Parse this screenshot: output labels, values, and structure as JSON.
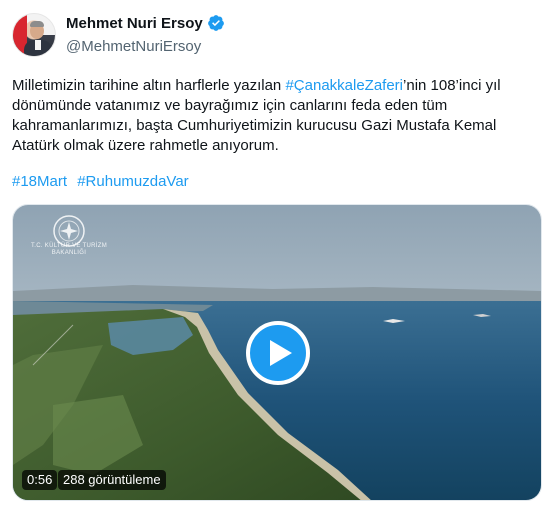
{
  "author": {
    "display_name": "Mehmet Nuri Ersoy",
    "handle": "@MehmetNuriErsoy",
    "verified": true
  },
  "tweet": {
    "text_before": "Milletimizin tarihine altın harflerle yazılan ",
    "hashtag_inline": "#ÇanakkaleZaferi",
    "text_after": "’nin 108’inci yıl dönümünde vatanımız ve bayrağımız için canlarını feda eden tüm kahramanlarımızı, başta Cumhuriyetimizin kurucusu Gazi Mustafa Kemal Atatürk olmak üzere rahmetle anıyorum.",
    "hashtags": [
      "#18Mart",
      "#RuhumuzdaVar"
    ]
  },
  "media": {
    "type": "video",
    "logo_text": "T.C. KÜLTÜR VE TURİZM BAKANLIĞI",
    "duration": "0:56",
    "views": "288 görüntüleme"
  },
  "colors": {
    "link": "#1d9bf0",
    "text": "#0f1419",
    "secondary": "#536471"
  }
}
